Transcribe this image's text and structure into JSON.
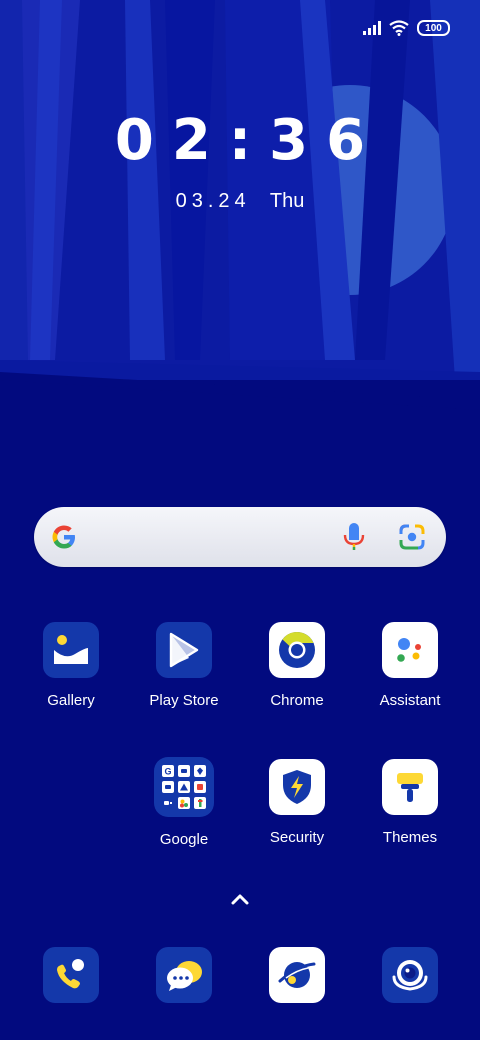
{
  "status_bar": {
    "battery": "100"
  },
  "lock": {
    "time": "02:36",
    "date": "03.24",
    "weekday": "Thu"
  },
  "search": {},
  "apps": {
    "gallery": "Gallery",
    "play_store": "Play Store",
    "chrome": "Chrome",
    "assistant": "Assistant",
    "google": "Google",
    "security": "Security",
    "themes": "Themes"
  },
  "colors": {
    "background": "#020a7f",
    "tile_blue": "#1438aa",
    "accent_yellow": "#fdd835"
  }
}
